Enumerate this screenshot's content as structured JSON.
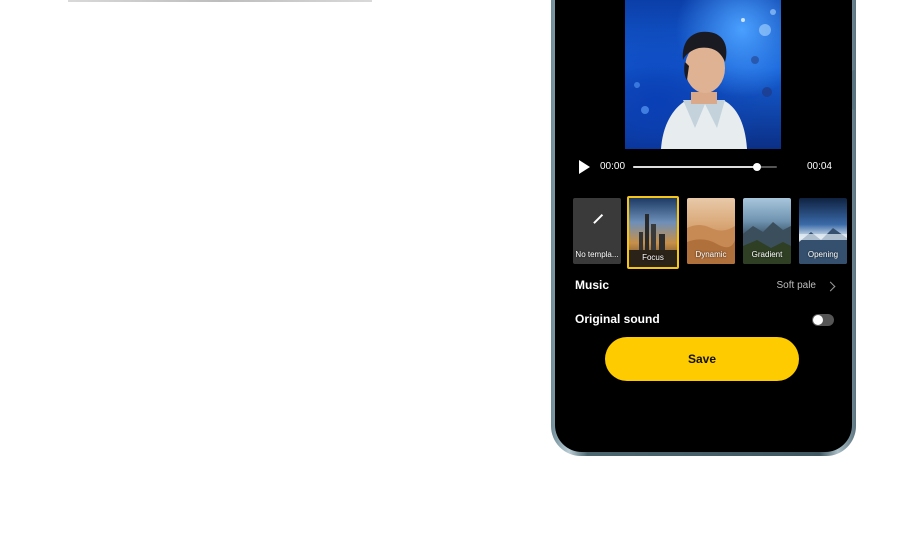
{
  "player": {
    "current_time": "00:00",
    "total_time": "00:04",
    "progress": 0.86
  },
  "templates": [
    {
      "label": "No templa...",
      "selected": false
    },
    {
      "label": "Focus",
      "selected": true
    },
    {
      "label": "Dynamic",
      "selected": false
    },
    {
      "label": "Gradient",
      "selected": false
    },
    {
      "label": "Opening",
      "selected": false
    }
  ],
  "music": {
    "label": "Music",
    "value": "Soft pale"
  },
  "original_sound": {
    "label": "Original sound",
    "enabled": false
  },
  "save_label": "Save",
  "colors": {
    "accent": "#fecb00",
    "selected_border": "#f5c518",
    "screen_bg": "#000000"
  }
}
